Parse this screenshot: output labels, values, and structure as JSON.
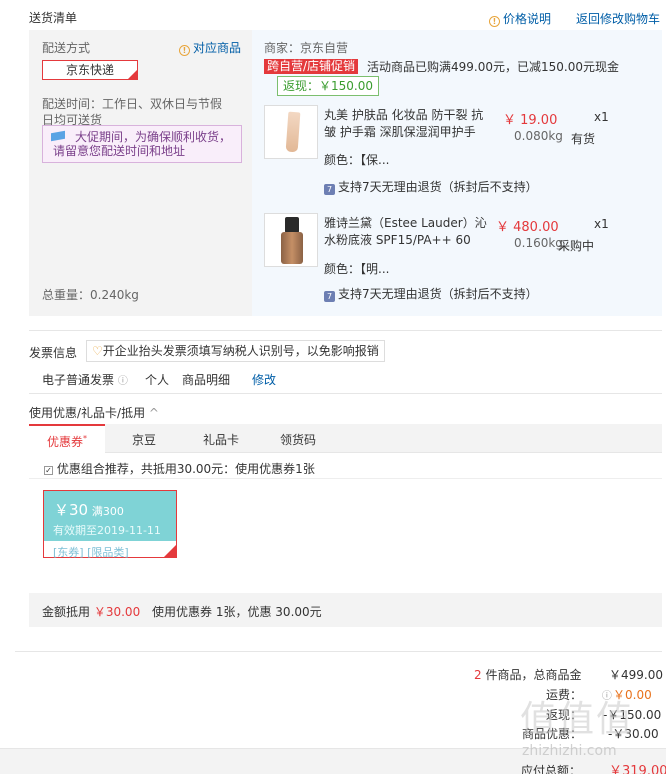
{
  "header": {
    "title": "送货清单",
    "price_note": "价格说明",
    "back_to_cart": "返回修改购物车"
  },
  "shipping": {
    "method_label": "配送方式",
    "match_goods": "对应商品",
    "method_value": "京东快递",
    "time_text": "配送时间：工作日、双休日与节假日均可送货",
    "notice": "大促期间，为确保顺利收货，请留意您配送时间和地址",
    "total_weight": "总重量：0.240kg"
  },
  "merchant": {
    "label": "商家：京东自营",
    "promo_tag": "跨自营/店铺促销",
    "promo_text": "活动商品已购满499.00元，已减150.00元现金",
    "rebate": "返现：￥150.00"
  },
  "items": [
    {
      "name": "丸美 护肤品 化妆品 防干裂 抗皱 护手霜 深肌保湿润甲护手",
      "price": "￥ 19.00",
      "qty": "x1",
      "weight": "0.080kg",
      "stock": "有货",
      "color": "颜色：【保...",
      "return": "支持7天无理由退货（拆封后不支持）"
    },
    {
      "name": "雅诗兰黛（Estee Lauder）沁水粉底液 SPF15/PA++ 60",
      "price": "￥ 480.00",
      "qty": "x1",
      "weight": "0.160kg",
      "stock": "采购中",
      "color": "颜色：【明...",
      "return": "支持7天无理由退货（拆封后不支持）"
    }
  ],
  "invoice": {
    "label": "发票信息",
    "tip": "开企业抬头发票须填写纳税人识别号，以免影响报销",
    "type": "电子普通发票",
    "title": "个人",
    "content": "商品明细",
    "edit": "修改"
  },
  "coupons": {
    "section_label": "使用优惠/礼品卡/抵用",
    "tabs": [
      "优惠券",
      "京豆",
      "礼品卡",
      "领货码"
    ],
    "recommend": "优惠组合推荐，共抵用30.00元：使用优惠券1张",
    "card": {
      "amount": "￥30",
      "condition": "满300",
      "expiry": "有效期至2019-11-11",
      "tags": "[东券] [限品类]"
    },
    "summary_label": "金额抵用",
    "summary_amount": "￥30.00",
    "summary_text": "使用优惠券 1张，优惠 30.00元"
  },
  "totals": {
    "count": "2",
    "count_text": "件商品，总商品金",
    "goods_amount": "￥499.00",
    "freight_label": "运费：",
    "freight": "￥0.00",
    "rebate_label": "返现：",
    "rebate": "-￥150.00",
    "coupon_label": "商品优惠：",
    "coupon": "-￥30.00",
    "payable_label": "应付总额：",
    "payable": "￥319.00"
  },
  "watermark": {
    "text": "值值值",
    "site": "zhizhizhi.com"
  }
}
